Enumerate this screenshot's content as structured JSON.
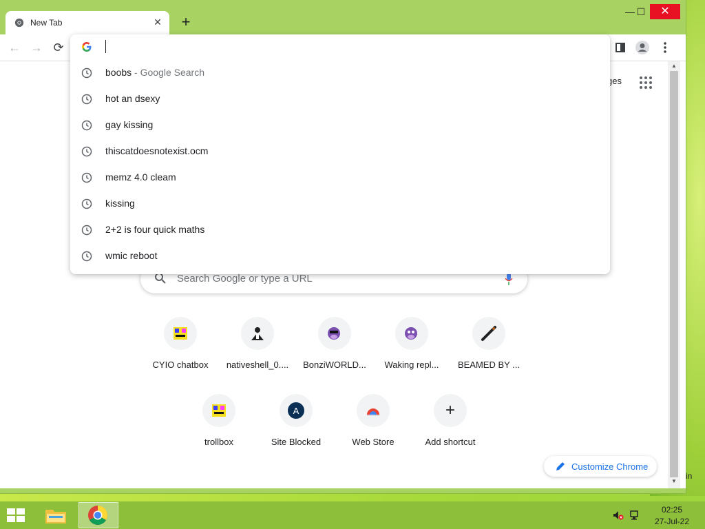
{
  "tab": {
    "title": "New Tab",
    "close": "✕"
  },
  "window_controls": {
    "minimize": "—",
    "maximize": "☐",
    "close": "✕"
  },
  "nav": {
    "back": "←",
    "forward": "→",
    "reload": "⟳"
  },
  "omnibox": {
    "value": "",
    "suggestions": [
      {
        "text": "boobs",
        "suffix": " - Google Search"
      },
      {
        "text": "hot an dsexy",
        "suffix": ""
      },
      {
        "text": "gay kissing",
        "suffix": ""
      },
      {
        "text": "thiscatdoesnotexist.ocm",
        "suffix": ""
      },
      {
        "text": "memz 4.0 cleam",
        "suffix": ""
      },
      {
        "text": "kissing",
        "suffix": ""
      },
      {
        "text": "2+2 is four quick maths",
        "suffix": ""
      },
      {
        "text": "wmic reboot",
        "suffix": ""
      }
    ]
  },
  "header": {
    "images_link": "ges"
  },
  "search": {
    "placeholder": "Search Google or type a URL"
  },
  "shortcuts": [
    {
      "label": "CYIO chatbox",
      "icon": "trollface-icon"
    },
    {
      "label": "nativeshell_0....",
      "icon": "person-icon"
    },
    {
      "label": "BonziWORLD...",
      "icon": "bonzi-icon"
    },
    {
      "label": "Waking repl...",
      "icon": "bonzi-icon"
    },
    {
      "label": "BEAMED BY ...",
      "icon": "beam-icon"
    },
    {
      "label": "trollbox",
      "icon": "trollface-icon"
    },
    {
      "label": "Site Blocked",
      "icon": "letter-a-icon",
      "letter": "A"
    },
    {
      "label": "Web Store",
      "icon": "webstore-icon"
    },
    {
      "label": "Add shortcut",
      "icon": "plus-icon",
      "glyph": "+"
    }
  ],
  "customize": {
    "label": "Customize Chrome"
  },
  "taskbar": {
    "time": "02:25",
    "date": "27-Jul-22"
  },
  "edge_text": "in",
  "colors": {
    "accent": "#1a73e8",
    "taskbar": "#8dbf3a",
    "frame": "#a8d261",
    "close_red": "#e81123"
  }
}
